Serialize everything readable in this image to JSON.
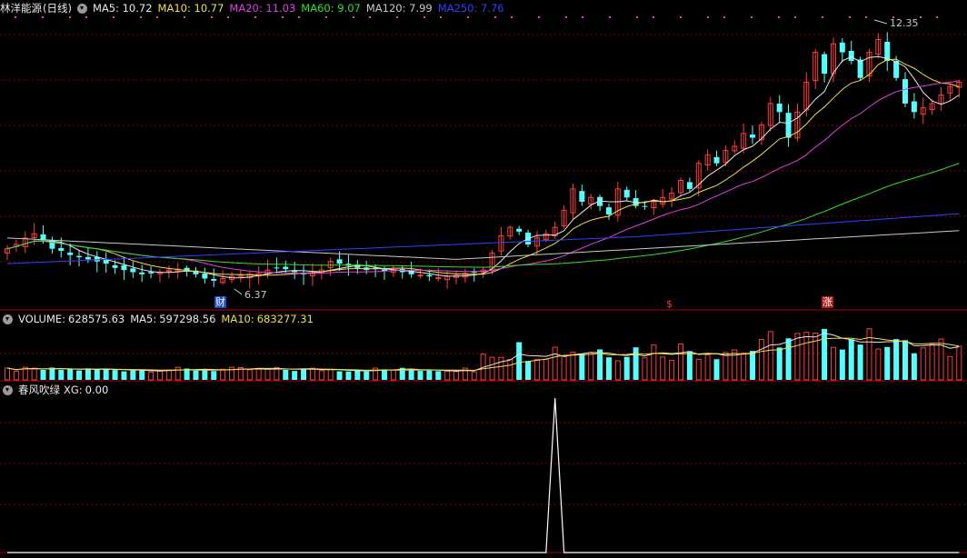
{
  "main": {
    "stock_name": "林洋能源",
    "period": "(日线)",
    "ma": [
      {
        "label": "MA5:",
        "value": "10.72",
        "color": "#e8e8e8"
      },
      {
        "label": "MA10:",
        "value": "10.77",
        "color": "#f0e040"
      },
      {
        "label": "MA20:",
        "value": "11.03",
        "color": "#e040e0"
      },
      {
        "label": "MA60:",
        "value": "9.07",
        "color": "#30e030"
      },
      {
        "label": "MA120:",
        "value": "7.99",
        "color": "#c8c8c8"
      },
      {
        "label": "MA250:",
        "value": "7.76",
        "color": "#3040ff"
      }
    ],
    "high_label": "12.35",
    "low_label": "6.37",
    "markers": [
      "财",
      "$",
      "涨"
    ]
  },
  "volume": {
    "label": "VOLUME:",
    "value": "628575.63",
    "ma5_label": "MA5:",
    "ma5_value": "597298.56",
    "ma10_label": "MA10:",
    "ma10_value": "683277.31"
  },
  "indicator": {
    "name": "春风吹绿",
    "xg_label": "XG:",
    "xg_value": "0.00"
  },
  "colors": {
    "up": "#ff3c3c",
    "down": "#54ffff",
    "grid": "#8b0000",
    "bg": "#000000"
  },
  "chart_data": {
    "type": "candlestick",
    "price_range": [
      6.0,
      12.6
    ],
    "closes": [
      7.2,
      7.3,
      7.45,
      7.55,
      7.4,
      7.2,
      7.15,
      7.05,
      7.0,
      6.95,
      6.9,
      6.85,
      6.75,
      6.7,
      6.65,
      6.6,
      6.62,
      6.65,
      6.7,
      6.72,
      6.68,
      6.6,
      6.5,
      6.45,
      6.5,
      6.55,
      6.58,
      6.6,
      6.62,
      6.7,
      6.75,
      6.72,
      6.65,
      6.6,
      6.62,
      6.7,
      6.9,
      6.85,
      6.8,
      6.75,
      6.7,
      6.72,
      6.68,
      6.7,
      6.65,
      6.6,
      6.58,
      6.55,
      6.52,
      6.55,
      6.58,
      6.62,
      6.65,
      6.7,
      7.1,
      7.5,
      7.7,
      7.6,
      7.3,
      7.45,
      7.55,
      7.7,
      8.1,
      8.6,
      8.3,
      8.4,
      8.2,
      8.0,
      8.6,
      8.4,
      8.2,
      8.2,
      8.3,
      8.4,
      8.5,
      8.8,
      8.6,
      9.2,
      9.4,
      9.2,
      9.5,
      9.6,
      9.9,
      9.8,
      10.1,
      10.6,
      10.4,
      9.8,
      10.4,
      11.1,
      11.8,
      11.3,
      12.0,
      11.8,
      11.6,
      11.2,
      11.8,
      12.1,
      11.6,
      11.2,
      10.6,
      10.4,
      10.5,
      10.6,
      10.8,
      11.0,
      11.1
    ],
    "volume_range": [
      0,
      1000000
    ],
    "volume_ma10_last": 683277.31,
    "xg_signal_index": 61,
    "xg_range": [
      0,
      1
    ]
  }
}
